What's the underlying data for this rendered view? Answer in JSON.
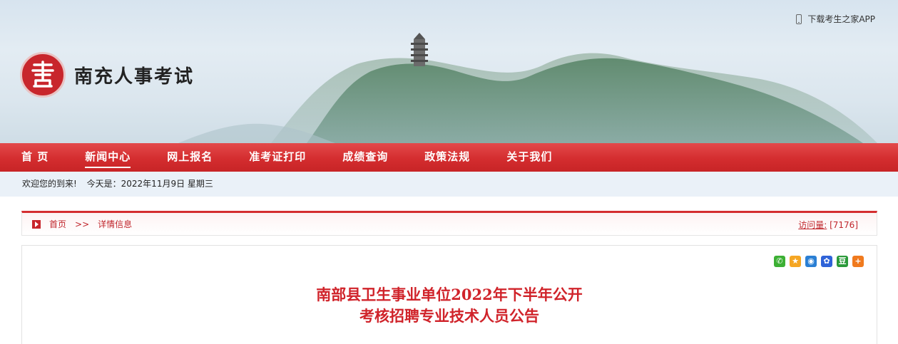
{
  "header": {
    "site_name": "南充人事考试",
    "logo_glyph": "書",
    "app_link": "下载考生之家APP"
  },
  "nav": {
    "items": [
      {
        "label": "首 页",
        "active": false
      },
      {
        "label": "新闻中心",
        "active": true
      },
      {
        "label": "网上报名",
        "active": false
      },
      {
        "label": "准考证打印",
        "active": false
      },
      {
        "label": "成绩查询",
        "active": false
      },
      {
        "label": "政策法规",
        "active": false
      },
      {
        "label": "关于我们",
        "active": false
      }
    ]
  },
  "welcome": {
    "greeting": "欢迎您的到来!",
    "today": "今天是：2022年11月9日 星期三"
  },
  "breadcrumb": {
    "home": "首页",
    "separator": ">>",
    "current": "详情信息",
    "visits_label": "访问量:",
    "visits_value": "[7176]"
  },
  "share": {
    "icons": [
      {
        "name": "wechat-share-icon",
        "color": "#3cb034"
      },
      {
        "name": "qzone-share-icon",
        "color": "#f5a623"
      },
      {
        "name": "qq-share-icon",
        "color": "#2a7fd4"
      },
      {
        "name": "baidu-share-icon",
        "color": "#2f63d8"
      },
      {
        "name": "douban-share-icon",
        "color": "#2b9a3a"
      },
      {
        "name": "more-share-icon",
        "color": "#f07a1e"
      }
    ]
  },
  "article": {
    "title_line1": "南部县卫生事业单位2022年下半年公开",
    "title_line2": "考核招聘专业技术人员公告"
  },
  "colors": {
    "accent_red": "#d42d2f",
    "title_red": "#d0232a"
  }
}
